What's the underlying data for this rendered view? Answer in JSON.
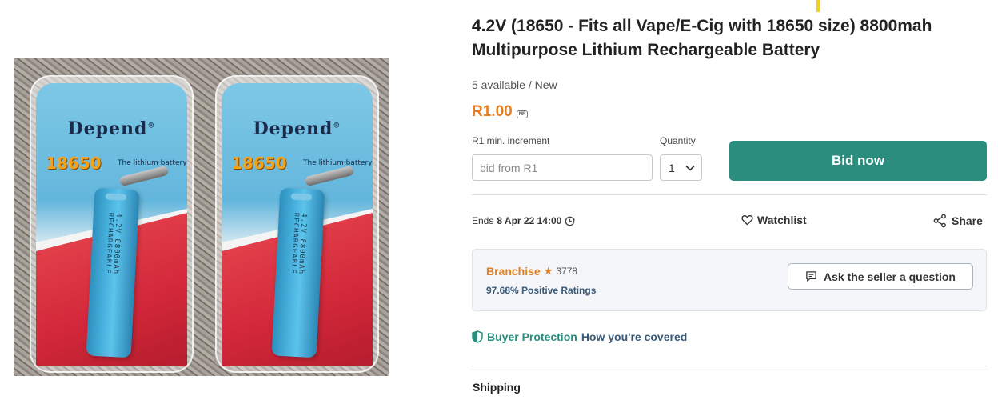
{
  "product": {
    "title": "4.2V (18650 - Fits all Vape/E-Cig with 18650 size) 8800mah Multipurpose Lithium Rechargeable Battery",
    "image": {
      "brand": "Depend",
      "reg_mark": "®",
      "model": "18650",
      "tagline": "The lithium battery",
      "battery_text": "4.2V 8800mAh RECHARGEABLE"
    },
    "availability": "5 available / New",
    "price": "R1.00",
    "price_badge": "NR"
  },
  "bid": {
    "increment_label": "R1 min. increment",
    "placeholder": "bid from R1",
    "quantity_label": "Quantity",
    "quantity_value": "1",
    "bid_button_label": "Bid now"
  },
  "meta": {
    "ends_prefix": "Ends",
    "ends_date": "8 Apr 22 14:00",
    "watchlist_label": "Watchlist",
    "share_label": "Share"
  },
  "seller": {
    "name": "Branchise",
    "score": "3778",
    "rating": "97.68% Positive Ratings",
    "ask_button_label": "Ask the seller a question"
  },
  "protection": {
    "label": "Buyer Protection",
    "link": "How you're covered"
  },
  "shipping": {
    "heading": "Shipping"
  },
  "colors": {
    "accent_orange": "#e67e22",
    "primary_green": "#2a8d7d",
    "link_blue": "#3a5a7a"
  },
  "icons": [
    "clock-icon",
    "heart-icon",
    "share-icon",
    "chat-icon",
    "shield-icon",
    "chevron-down-icon",
    "star-icon"
  ]
}
